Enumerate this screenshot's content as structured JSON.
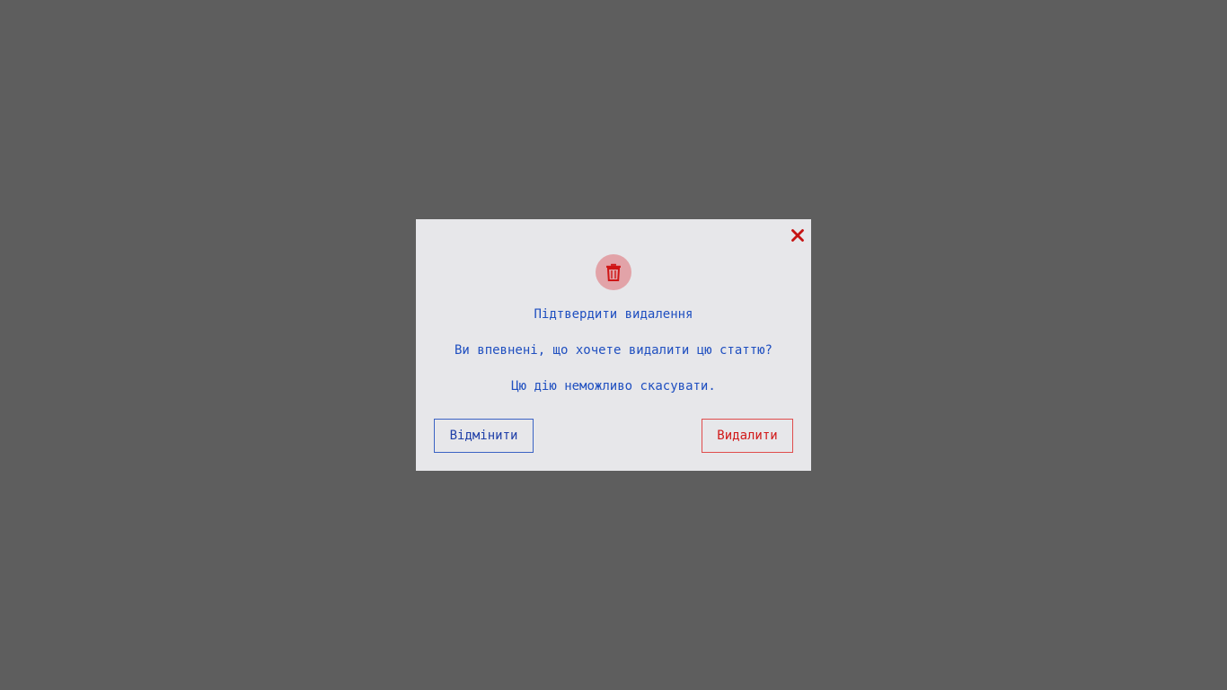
{
  "dialog": {
    "title": "Підтвердити видалення",
    "message": "Ви впевнені, що хочете видалити цю статтю?",
    "warning": "Цю дію неможливо скасувати.",
    "cancel_label": "Відмінити",
    "delete_label": "Видалити",
    "icons": {
      "close": "close-icon",
      "header": "trash-icon"
    }
  },
  "colors": {
    "overlay": "#5e5e5e",
    "dialog_bg": "#e7e7ea",
    "text": "#1f4fc0",
    "danger": "#d11a1a",
    "icon_circle": "#e2a3a8"
  }
}
